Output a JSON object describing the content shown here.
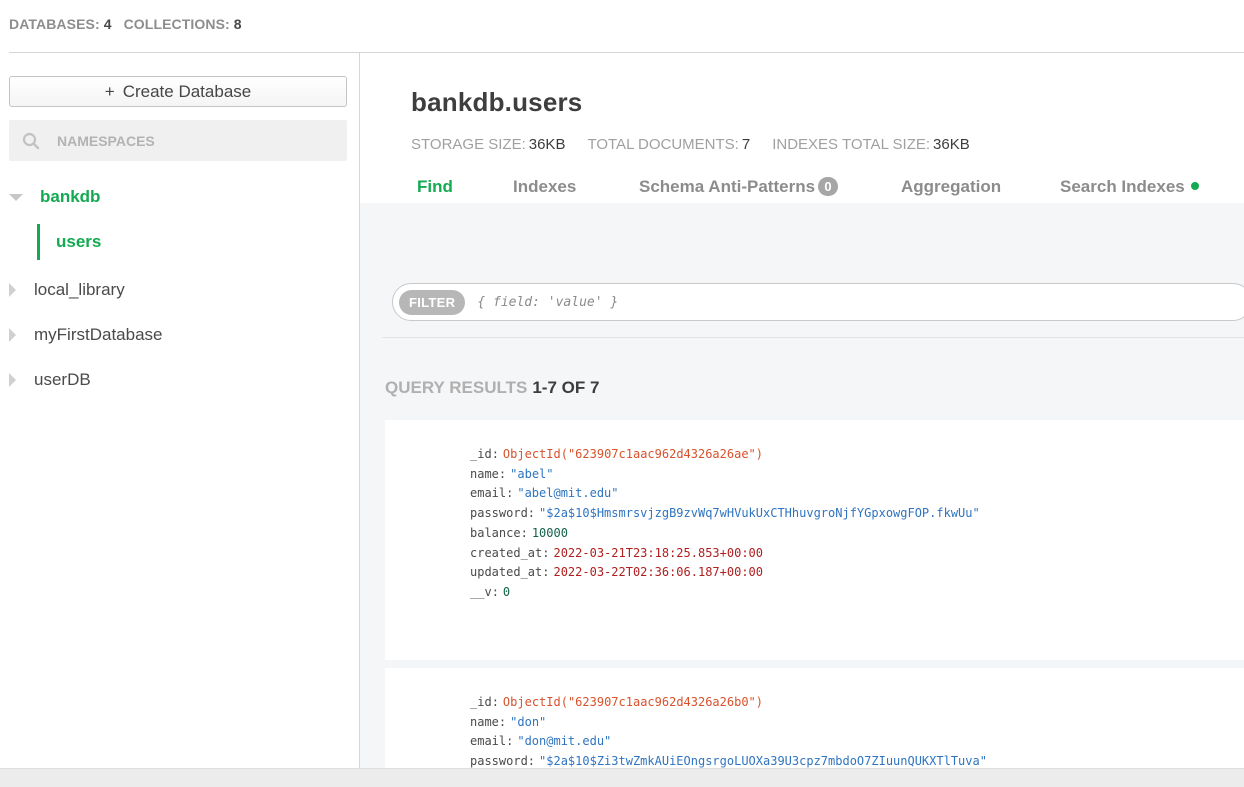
{
  "topbar": {
    "databases_label": "DATABASES:",
    "databases_count": "4",
    "collections_label": "COLLECTIONS:",
    "collections_count": "8"
  },
  "sidebar": {
    "create_button_label": "Create Database",
    "create_button_icon": "+",
    "search_placeholder": "NAMESPACES",
    "databases": [
      {
        "name": "bankdb",
        "expanded": true,
        "collections": [
          "users"
        ]
      },
      {
        "name": "local_library",
        "expanded": false
      },
      {
        "name": "myFirstDatabase",
        "expanded": false
      },
      {
        "name": "userDB",
        "expanded": false
      }
    ]
  },
  "collection": {
    "title": "bankdb.users",
    "storage_size_label": "STORAGE SIZE:",
    "storage_size": "36KB",
    "total_documents_label": "TOTAL DOCUMENTS:",
    "total_documents": "7",
    "indexes_total_size_label": "INDEXES TOTAL SIZE:",
    "indexes_total_size": "36KB"
  },
  "tabs": {
    "find": "Find",
    "indexes": "Indexes",
    "schema": "Schema Anti-Patterns",
    "schema_badge": "0",
    "aggregation": "Aggregation",
    "search_indexes": "Search Indexes"
  },
  "filter": {
    "label": "FILTER",
    "placeholder": "{ field: 'value' }"
  },
  "results": {
    "label": "QUERY RESULTS",
    "range": "1-7 OF 7"
  },
  "documents": [
    {
      "_id": "ObjectId(\"623907c1aac962d4326a26ae\")",
      "name": "\"abel\"",
      "email": "\"abel@mit.edu\"",
      "password": "\"$2a$10$HmsmrsvjzgB9zvWq7wHVukUxCTHhuvgroNjfYGpxowgFOP.fkwUu\"",
      "balance": "10000",
      "created_at": "2022-03-21T23:18:25.853+00:00",
      "updated_at": "2022-03-22T02:36:06.187+00:00",
      "__v": "0"
    },
    {
      "_id": "ObjectId(\"623907c1aac962d4326a26b0\")",
      "name": "\"don\"",
      "email": "\"don@mit.edu\"",
      "password": "\"$2a$10$Zi3twZmkAUiEOngsrgoLUOXa39U3cpz7mbdoO7ZIuunQUKXTlTuva\""
    }
  ],
  "colors": {
    "accent_green": "#13aa52",
    "objectid": "#d9522c",
    "string": "#2f74c0",
    "number": "#136149",
    "date": "#b01e1e"
  }
}
